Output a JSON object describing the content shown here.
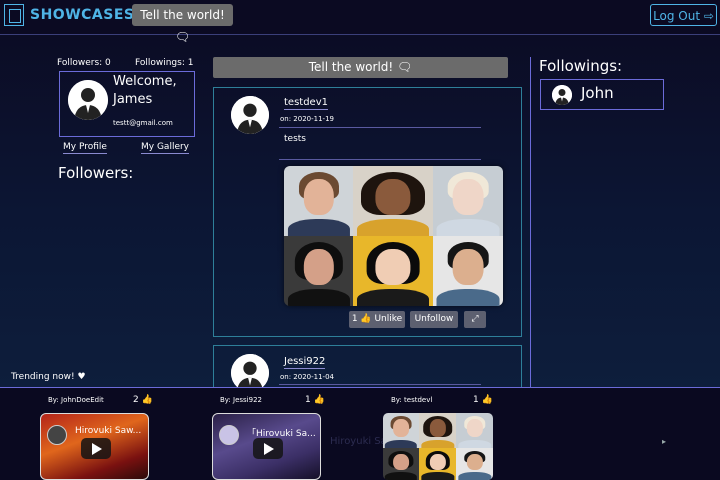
{
  "nav": {
    "brand": "SHOWCASES",
    "tell_world": "Tell the world! 🗨",
    "logout": "Log Out ⇨"
  },
  "profile": {
    "followers_count": "Followers: 0",
    "followings_count": "Followings: 1",
    "welcome": "Welcome, James",
    "email": "testt@gmail.com",
    "my_profile": "My Profile",
    "my_gallery": "My Gallery",
    "followers_heading": "Followers:"
  },
  "feed": {
    "tell_world": "Tell the world! 🗨",
    "posts": [
      {
        "user": "testdev1",
        "date": "on: 2020-11-19",
        "text": "tests",
        "like_label": "1 👍 Unlike",
        "unfollow_label": "Unfollow",
        "expand_icon": "⤢"
      },
      {
        "user": "Jessi922",
        "date": "on: 2020-11-04"
      }
    ]
  },
  "followings": {
    "heading": "Followings:",
    "users": [
      {
        "name": "John"
      }
    ]
  },
  "trending": {
    "label": "Trending now! ♥",
    "items": [
      {
        "by": "By: JohnDoeEdit",
        "count": "2 👍",
        "title": "Hirovuki Saw..."
      },
      {
        "by": "By: Jessi922",
        "count": "1 👍",
        "title": "「Hirovuki Sa..."
      },
      {
        "by": "By: testdevl",
        "count": "1 👍"
      }
    ],
    "ghost": "Hiroyuki Sa",
    "next_icon": "▸"
  },
  "colors": {
    "accent": "#4fb4e6",
    "border": "#6b6bd9",
    "post_border": "#2e7f99",
    "button_grey": "#5d6070"
  }
}
